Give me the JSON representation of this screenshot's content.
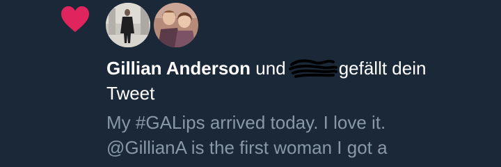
{
  "notification": {
    "icon": "heart-icon",
    "accent_color": "#e0245e",
    "avatars": [
      "avatar-gillian-anderson",
      "avatar-second-user"
    ],
    "liker_name": "Gillian Anderson",
    "conjunction": "und",
    "action_text": "gefällt dein",
    "object_text": "Tweet",
    "tweet_line_1": "My #GALips arrived today. I love it.",
    "tweet_line_2": "@GillianA is the first woman I got a"
  },
  "colors": {
    "background": "#1b2837",
    "primary_text": "#ffffff",
    "secondary_text": "#8899a6"
  }
}
